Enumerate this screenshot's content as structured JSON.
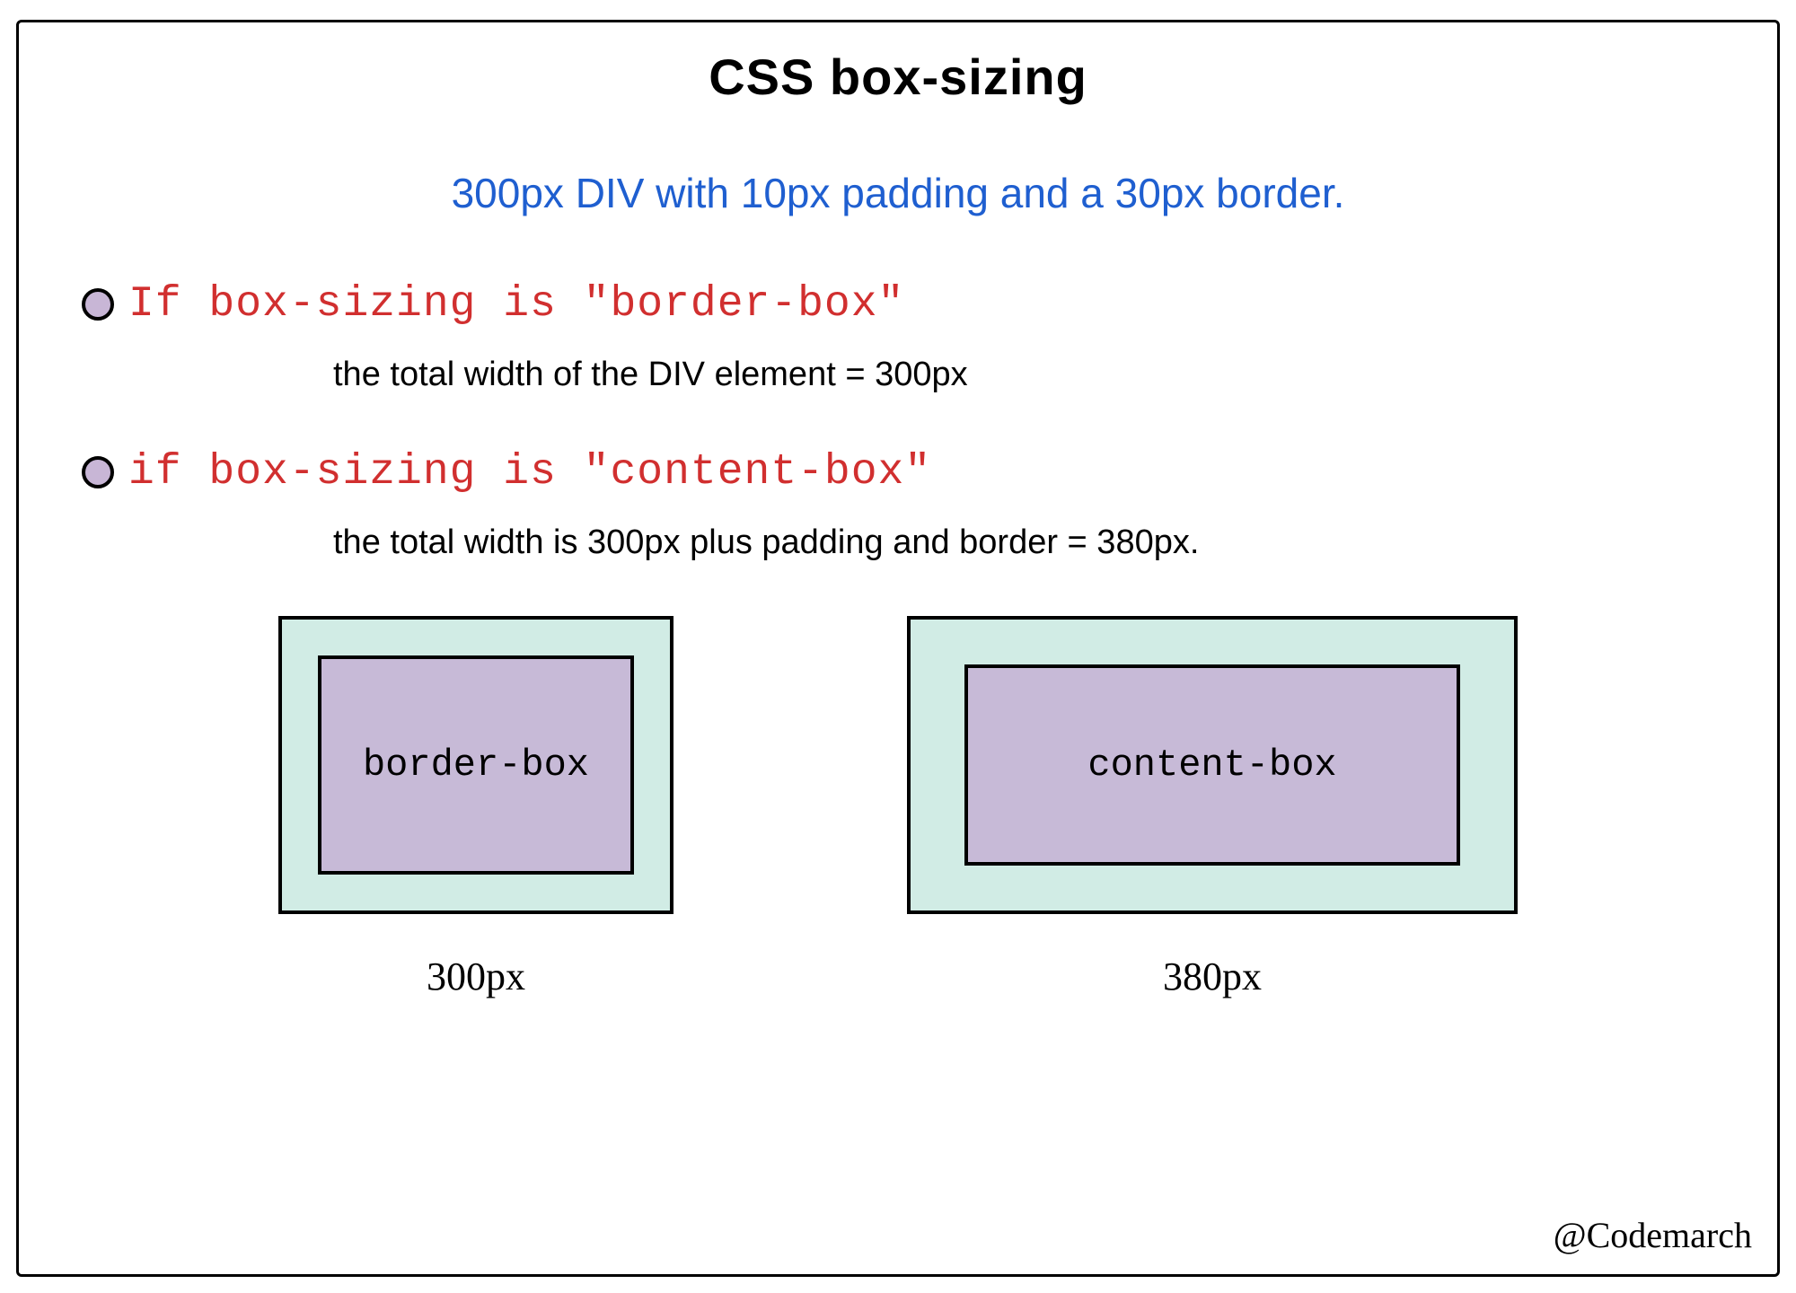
{
  "title": "CSS box-sizing",
  "subtitle": "300px DIV with 10px padding and a 30px border.",
  "bullets": [
    {
      "heading": "If box-sizing is \"border-box\"",
      "body": "the total width of the DIV element = 300px"
    },
    {
      "heading": "if box-sizing is \"content-box\"",
      "body": "the total width is 300px plus padding and border = 380px."
    }
  ],
  "boxes": {
    "left": {
      "label": "border-box",
      "caption": "300px"
    },
    "right": {
      "label": "content-box",
      "caption": "380px"
    }
  },
  "credit": "@Codemarch",
  "colors": {
    "accent_blue": "#1f5fd0",
    "accent_red": "#d12f2f",
    "border_fill": "#d1ece5",
    "content_fill": "#c7bad7"
  }
}
